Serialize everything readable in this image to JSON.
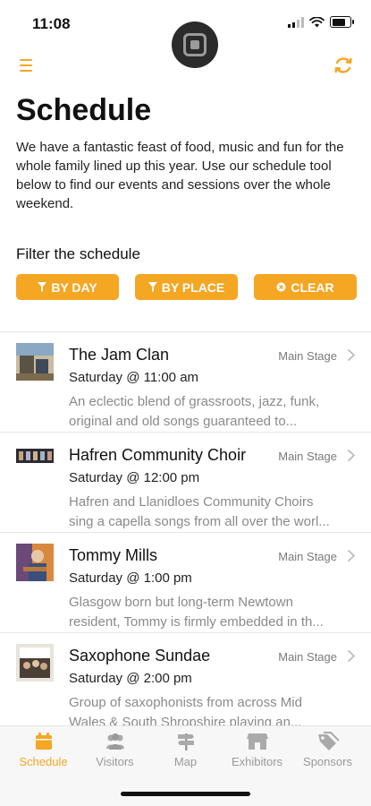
{
  "status_bar": {
    "time": "11:08"
  },
  "header": {
    "menu_icon": "hamburger-menu-icon",
    "refresh_icon": "refresh-icon",
    "accent_color": "#F5A623"
  },
  "page": {
    "title": "Schedule",
    "intro": "We have a fantastic feast of food, music and fun for the whole family lined up this year. Use our schedule tool below to find our events and sessions over the whole weekend."
  },
  "filters": {
    "heading": "Filter the schedule",
    "buttons": [
      {
        "label": "BY DAY",
        "icon": "funnel-icon"
      },
      {
        "label": "BY PLACE",
        "icon": "funnel-icon"
      },
      {
        "label": "CLEAR",
        "icon": "clear-icon"
      }
    ]
  },
  "events": [
    {
      "title": "The Jam Clan",
      "place": "Main Stage",
      "time": "Saturday @ 11:00 am",
      "desc_line1": "An eclectic blend of grassroots, jazz, funk,",
      "desc_line2": "original and old songs guaranteed to..."
    },
    {
      "title": "Hafren Community Choir",
      "place": "Main Stage",
      "time": "Saturday @ 12:00 pm",
      "desc_line1": "Hafren and Llanidloes Community Choirs",
      "desc_line2": "sing a capella songs from all over the worl..."
    },
    {
      "title": "Tommy Mills",
      "place": "Main Stage",
      "time": "Saturday @ 1:00 pm",
      "desc_line1": "Glasgow born but long-term Newtown",
      "desc_line2": "resident, Tommy is firmly embedded in th..."
    },
    {
      "title": "Saxophone Sundae",
      "place": "Main Stage",
      "time": "Saturday @ 2:00 pm",
      "desc_line1": "Group of saxophonists from across Mid",
      "desc_line2": "Wales & South Shropshire playing an..."
    }
  ],
  "tabs": [
    {
      "label": "Schedule",
      "icon": "calendar-icon",
      "active": true
    },
    {
      "label": "Visitors",
      "icon": "people-icon"
    },
    {
      "label": "Map",
      "icon": "signpost-icon"
    },
    {
      "label": "Exhibitors",
      "icon": "shop-icon"
    },
    {
      "label": "Sponsors",
      "icon": "tags-icon"
    }
  ]
}
